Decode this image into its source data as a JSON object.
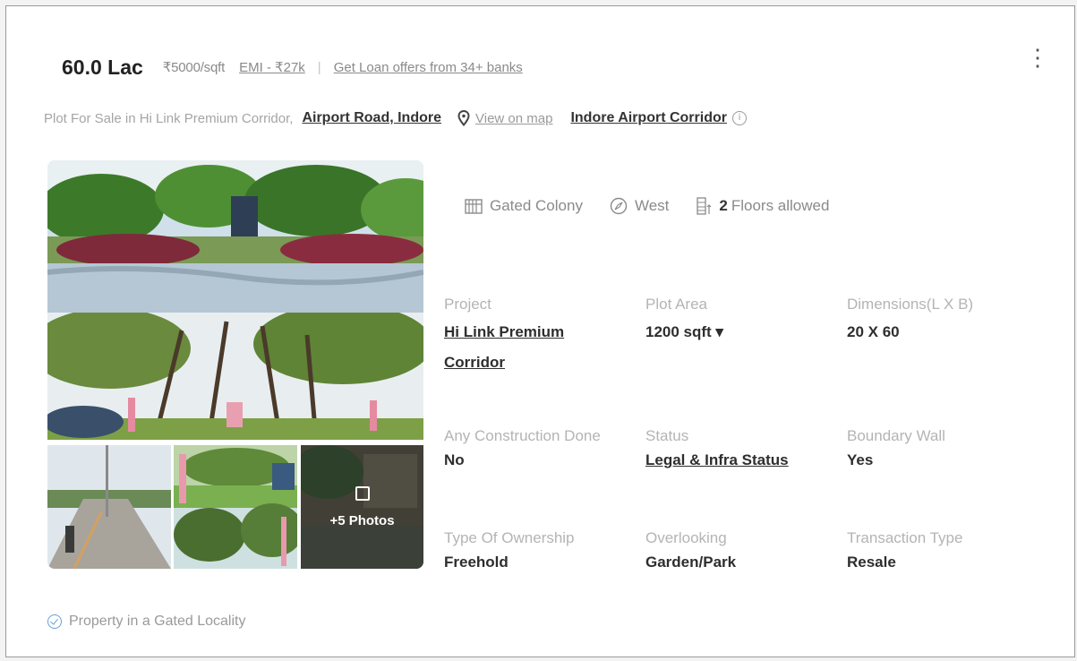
{
  "listing": {
    "price": "60.0 Lac",
    "per_sqft": "₹5000/sqft",
    "emi": "EMI - ₹27k",
    "separator": "|",
    "loan_offer": "Get Loan offers from 34+ banks",
    "menu_icon": "more-vertical-icon"
  },
  "location": {
    "title": "Plot For Sale in Hi Link Premium Corridor,",
    "locality_link": "Airport Road, Indore",
    "map_link": "View on map",
    "corridor_link": "Indore Airport Corridor",
    "info_icon": "i"
  },
  "gallery": {
    "more_photos_label": "+5 Photos"
  },
  "amenities": [
    {
      "icon": "gated-colony-icon",
      "label": "Gated Colony"
    },
    {
      "icon": "compass-icon",
      "label": "West"
    },
    {
      "icon": "floors-icon",
      "count": "2",
      "label": "Floors allowed"
    }
  ],
  "details": [
    {
      "label": "Project",
      "value": "Hi Link Premium Corridor",
      "style": "link"
    },
    {
      "label": "Plot Area",
      "value": "1200 sqft ▾",
      "style": "bold"
    },
    {
      "label": "Dimensions(L X B)",
      "value": "20 X 60",
      "style": "bold"
    },
    {
      "label": "Any Construction Done",
      "value": "No",
      "style": "bold"
    },
    {
      "label": "Status",
      "value": "Legal & Infra Status",
      "style": "link"
    },
    {
      "label": "Boundary Wall",
      "value": "Yes",
      "style": "bold"
    },
    {
      "label": "Type Of Ownership",
      "value": "Freehold",
      "style": "bold"
    },
    {
      "label": "Overlooking",
      "value": "Garden/Park",
      "style": "bold"
    },
    {
      "label": "Transaction Type",
      "value": "Resale",
      "style": "bold"
    }
  ],
  "footer": {
    "gated_locality": "Property in a Gated Locality"
  }
}
